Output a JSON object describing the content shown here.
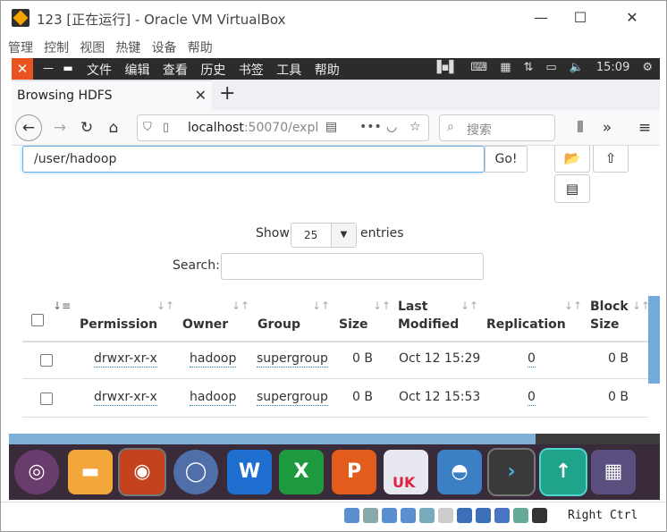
{
  "window": {
    "title": "123 [正在运行] - Oracle VM VirtualBox",
    "min": "—",
    "max": "☐",
    "close": "✕"
  },
  "vbox_menu": [
    "管理",
    "控制",
    "视图",
    "热键",
    "设备",
    "帮助"
  ],
  "ubuntu_panel": {
    "close": "✕",
    "min": "—",
    "max": "▬",
    "menus": [
      "文件",
      "编辑",
      "查看",
      "历史",
      "书签",
      "工具",
      "帮助"
    ],
    "time": "15:09"
  },
  "browser": {
    "tab_title": "Browsing HDFS",
    "tab_close": "✕",
    "new_tab": "+",
    "url_host": "localhost",
    "url_rest": ":50070/expl",
    "search_placeholder": "搜索"
  },
  "page": {
    "path_value": "/user/hadoop",
    "go_label": "Go!",
    "show_label": "Show",
    "entries_value": "25",
    "entries_label": "entries",
    "search_label": "Search:",
    "columns": {
      "permission": "Permission",
      "owner": "Owner",
      "group": "Group",
      "size": "Size",
      "last": "Last",
      "modified": "Modified",
      "replication": "Replication",
      "block": "Block",
      "bsize": "Size"
    },
    "rows": [
      {
        "permission": "drwxr-xr-x",
        "owner": "hadoop",
        "group": "supergroup",
        "size": "0 B",
        "modified": "Oct 12 15:29",
        "replication": "0",
        "block_size": "0 B"
      },
      {
        "permission": "drwxr-xr-x",
        "owner": "hadoop",
        "group": "supergroup",
        "size": "0 B",
        "modified": "Oct 12 15:53",
        "replication": "0",
        "block_size": "0 B"
      }
    ]
  },
  "dock": {
    "items": [
      "ubuntu",
      "files",
      "firefox",
      "chromium",
      "writer",
      "calc",
      "impress",
      "software",
      "installer",
      "terminal",
      "updater",
      "virtualbox"
    ],
    "uk_label": "UK"
  },
  "statusbar": {
    "host_key": "Right Ctrl"
  },
  "colors": {
    "ubuntu_orange": "#e95420",
    "focus_blue": "#66afe9",
    "link_dotted": "#2a7ab0"
  }
}
